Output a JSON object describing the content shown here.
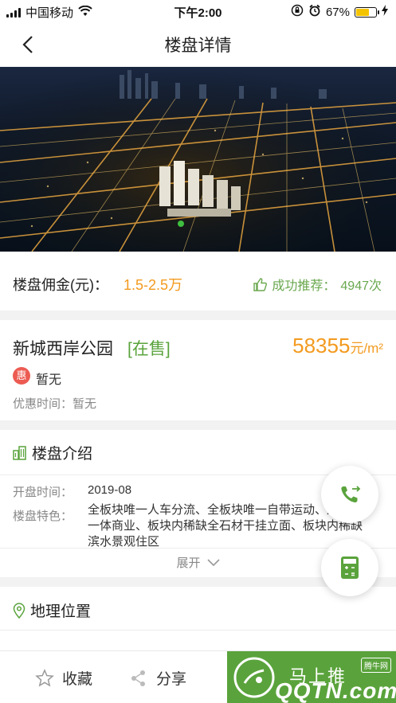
{
  "status_bar": {
    "carrier": "中国移动",
    "time": "下午2:00",
    "battery_percent": "67%",
    "battery_level": 0.67,
    "icons": [
      "signal-icon",
      "wifi-icon",
      "orientation-lock-icon",
      "alarm-icon",
      "battery-icon",
      "charging-icon"
    ]
  },
  "nav": {
    "title": "楼盘详情",
    "back_icon": "chevron-left-icon"
  },
  "hero": {
    "image": "night city aerial photo",
    "marker_color": "#3fbf3f"
  },
  "commission": {
    "label": "楼盘佣金(元)：",
    "value": "1.5-2.5万",
    "recommend_label": "成功推荐：",
    "recommend_count": "4947次",
    "icon": "thumbs-up-icon"
  },
  "project": {
    "name": "新城西岸公园",
    "status": "[在售]",
    "price": "58355",
    "price_unit": "元/m²",
    "discount_badge": "惠",
    "discount_text": "暂无",
    "discount_time_label": "优惠时间：",
    "discount_time_value": "暂无"
  },
  "intro": {
    "title": "楼盘介绍",
    "icon": "building-icon",
    "open_date_label": "开盘时间：",
    "open_date": "2019-08",
    "features_label": "楼盘特色：",
    "features": "全板块唯一人车分流、全板块唯一自带运动、及室内一体商业、板块内稀缺全石材干挂立面、板块内稀缺滨水景观住区",
    "expand_label": "展开"
  },
  "location": {
    "title": "地理位置",
    "icon": "location-pin-icon"
  },
  "fabs": {
    "call_icon": "phone-forward-icon",
    "calc_icon": "calculator-icon"
  },
  "bottom": {
    "favorite_label": "收藏",
    "share_label": "分享",
    "cta_label": "马上推",
    "watermark_text": "QQTN.com",
    "watermark_badge": "腾牛网"
  },
  "colors": {
    "accent_orange": "#f39a1f",
    "accent_green": "#5aa33c",
    "badge_red": "#ec5b52"
  }
}
